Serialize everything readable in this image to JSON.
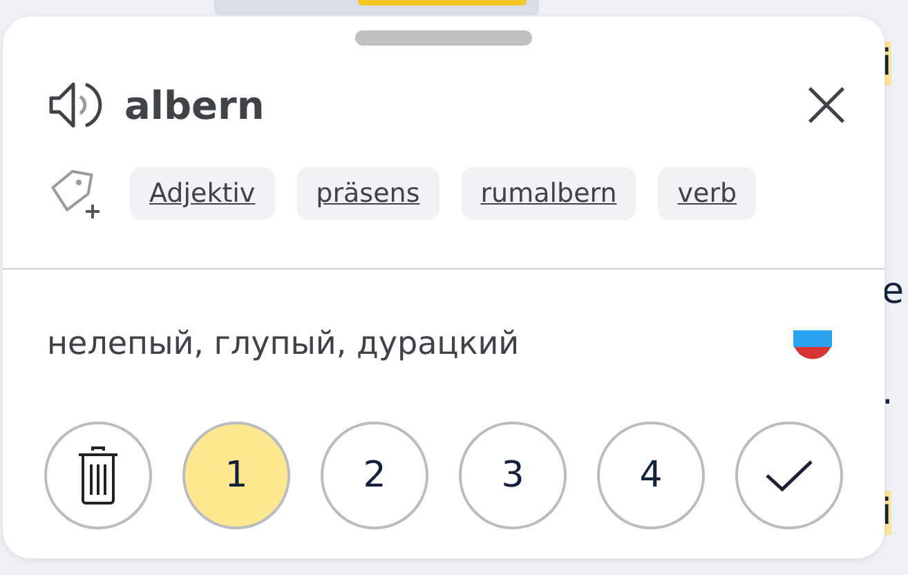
{
  "background_texts": [
    {
      "text": "i",
      "highlighted": true
    },
    {
      "text": "e",
      "highlighted": false
    },
    {
      "text": ".",
      "highlighted": false
    },
    {
      "text": "i",
      "highlighted": true
    }
  ],
  "card": {
    "word": "albern",
    "tags": [
      {
        "label": "Adjektiv"
      },
      {
        "label": "präsens"
      },
      {
        "label": "rumalbern"
      },
      {
        "label": "verb"
      }
    ],
    "translation": "нелепый, глупый, дурацкий",
    "buttons": [
      {
        "kind": "delete",
        "selected": false
      },
      {
        "kind": "level",
        "label": "1",
        "selected": true
      },
      {
        "kind": "level",
        "label": "2",
        "selected": false
      },
      {
        "kind": "level",
        "label": "3",
        "selected": false
      },
      {
        "kind": "level",
        "label": "4",
        "selected": false
      },
      {
        "kind": "done",
        "selected": false
      }
    ]
  }
}
